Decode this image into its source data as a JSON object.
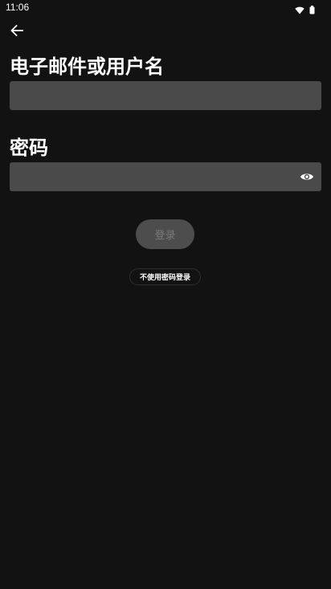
{
  "status_bar": {
    "time": "11:06",
    "icons": [
      "wifi-icon",
      "battery-icon"
    ]
  },
  "header": {
    "back_icon": "arrow-left-icon"
  },
  "form": {
    "email_label": "电子邮件或用户名",
    "email_value": "",
    "password_label": "密码",
    "password_value": "",
    "password_toggle_icon": "eye-icon"
  },
  "actions": {
    "login_label": "登录",
    "passwordless_label": "不使用密码登录"
  },
  "colors": {
    "background": "#121212",
    "field_background": "#4a4a4a",
    "disabled_button": "#4d4d4d",
    "disabled_text": "#7a7a7a"
  }
}
